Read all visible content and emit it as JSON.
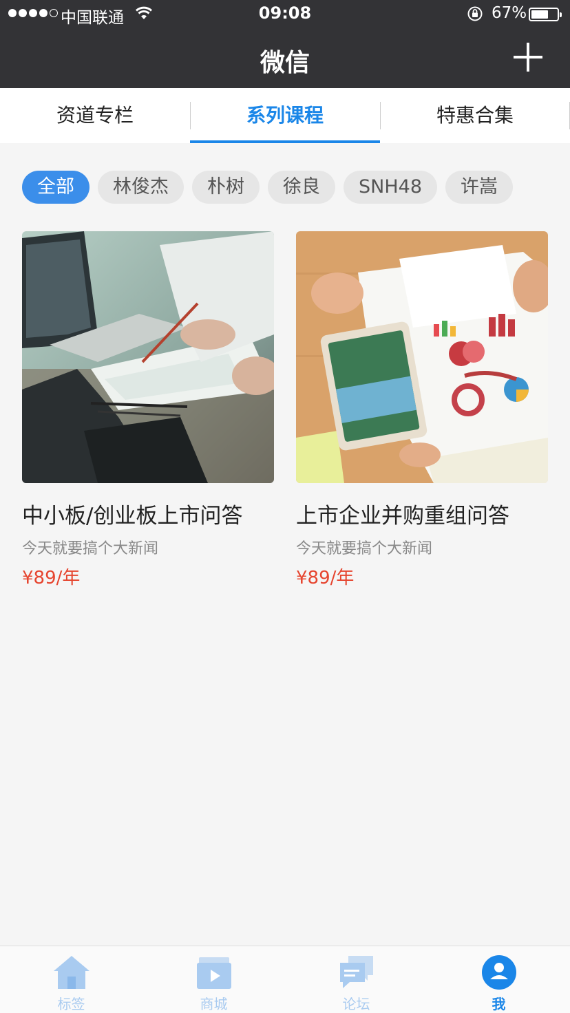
{
  "status_bar": {
    "carrier": "中国联通",
    "time": "09:08",
    "battery_percent": "67%",
    "battery_level": 0.67,
    "signal_bars_filled": 4,
    "signal_bars_total": 5
  },
  "nav": {
    "title": "微信",
    "add_icon": "plus-icon"
  },
  "tabs": [
    {
      "label": "资道专栏",
      "active": false
    },
    {
      "label": "系列课程",
      "active": true
    },
    {
      "label": "特惠合集",
      "active": false
    }
  ],
  "filters": [
    {
      "label": "全部",
      "active": true
    },
    {
      "label": "林俊杰",
      "active": false
    },
    {
      "label": "朴树",
      "active": false
    },
    {
      "label": "徐良",
      "active": false
    },
    {
      "label": "SNH48",
      "active": false
    },
    {
      "label": "许嵩",
      "active": false
    }
  ],
  "courses": [
    {
      "title": "中小板/创业板上市问答",
      "subtitle": "今天就要搞个大新闻",
      "price": "¥89/年",
      "image": "laptop-writing-photo"
    },
    {
      "title": "上市企业并购重组问答",
      "subtitle": "今天就要搞个大新闻",
      "price": "¥89/年",
      "image": "tablet-charts-photo"
    }
  ],
  "tabbar": [
    {
      "label": "标签",
      "icon": "home-icon",
      "active": false
    },
    {
      "label": "商城",
      "icon": "video-store-icon",
      "active": false
    },
    {
      "label": "论坛",
      "icon": "chat-icon",
      "active": false
    },
    {
      "label": "我",
      "icon": "user-icon",
      "active": true
    }
  ],
  "colors": {
    "accent": "#1a86e8",
    "price": "#e6452f",
    "navbar": "#333336",
    "tabbar_inactive": "#a9cbf0"
  }
}
